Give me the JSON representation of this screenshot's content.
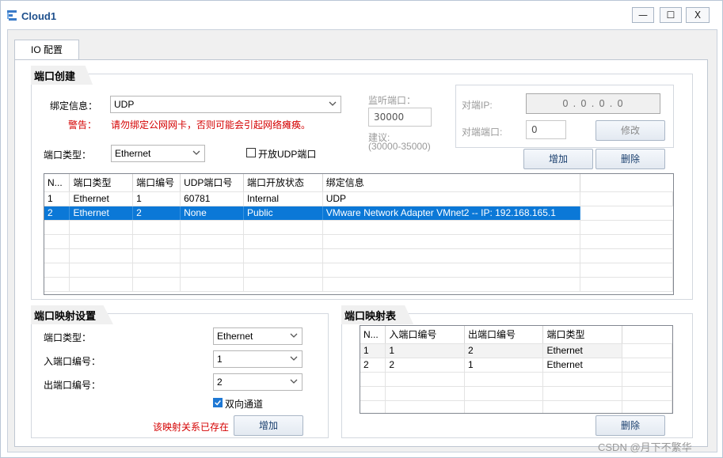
{
  "window": {
    "title": "Cloud1",
    "min": "—",
    "max": "☐",
    "close": "X"
  },
  "tab_label": "IO 配置",
  "port_create": {
    "title": "端口创建",
    "bind_label": "绑定信息：",
    "bind_value": "UDP",
    "warn_label": "警告：",
    "warn_text": "请勿绑定公网网卡，否则可能会引起网络瘫痪。",
    "porttype_label": "端口类型：",
    "porttype_value": "Ethernet",
    "udp_open_label": "开放UDP端口",
    "listen_label": "监听端口：",
    "listen_value": "30000",
    "suggest_label": "建议:",
    "suggest_range": "(30000-35000)",
    "peer_ip_label": "对端IP:",
    "peer_ip_value": "0 . 0 . 0 . 0",
    "peer_port_label": "对端端口:",
    "peer_port_value": "0",
    "modify_btn": "修改",
    "add_btn": "增加",
    "delete_btn": "删除",
    "columns": [
      "N...",
      "端口类型",
      "端口编号",
      "UDP端口号",
      "端口开放状态",
      "绑定信息"
    ],
    "rows": [
      [
        "1",
        "Ethernet",
        "1",
        "60781",
        "Internal",
        "UDP"
      ],
      [
        "2",
        "Ethernet",
        "2",
        "None",
        "Public",
        "VMware Network Adapter VMnet2 -- IP: 192.168.165.1"
      ]
    ],
    "selected_row": 1
  },
  "mapping_settings": {
    "title": "端口映射设置",
    "porttype_label": "端口类型：",
    "porttype_value": "Ethernet",
    "in_label": "入端口编号：",
    "in_value": "1",
    "out_label": "出端口编号：",
    "out_value": "2",
    "bidir_label": "双向通道",
    "exists_msg": "该映射关系已存在",
    "add_btn": "增加"
  },
  "mapping_table": {
    "title": "端口映射表",
    "columns": [
      "N...",
      "入端口编号",
      "出端口编号",
      "端口类型"
    ],
    "rows": [
      [
        "1",
        "1",
        "2",
        "Ethernet"
      ],
      [
        "2",
        "2",
        "1",
        "Ethernet"
      ]
    ],
    "delete_btn": "删除"
  },
  "watermark": "CSDN @月下不繁华",
  "colors": {
    "accent": "#0b78d7",
    "warn": "#d40000",
    "title": "#1d4f8c"
  }
}
